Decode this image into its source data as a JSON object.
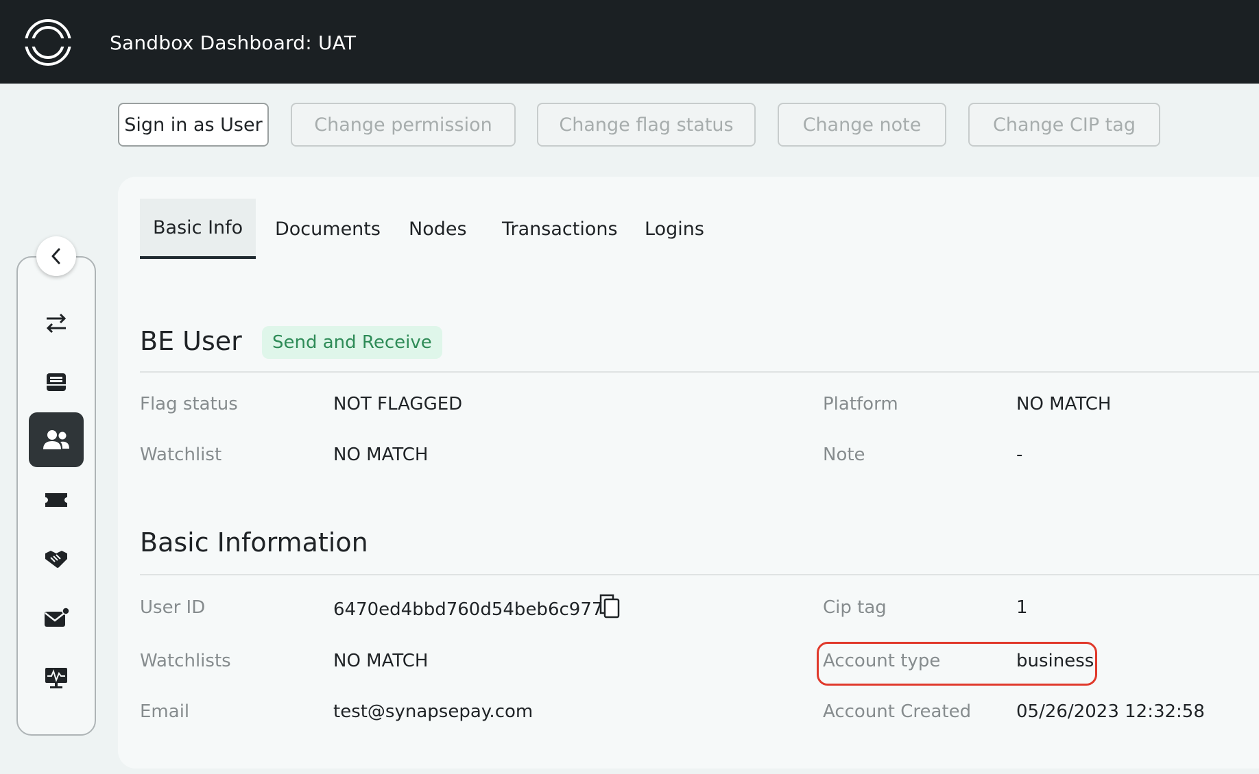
{
  "header": {
    "title": "Sandbox Dashboard: UAT"
  },
  "actions": {
    "sign_in": "Sign in as User",
    "change_permission": "Change permission",
    "change_flag_status": "Change flag status",
    "change_note": "Change note",
    "change_cip_tag": "Change CIP tag"
  },
  "tabs": [
    "Basic Info",
    "Documents",
    "Nodes",
    "Transactions",
    "Logins"
  ],
  "user": {
    "name": "BE User",
    "permission_badge": "Send and Receive"
  },
  "flags": {
    "flag_status_label": "Flag status",
    "flag_status_value": "NOT FLAGGED",
    "watchlist_label": "Watchlist",
    "watchlist_value": "NO MATCH",
    "platform_label": "Platform",
    "platform_value": "NO MATCH",
    "note_label": "Note",
    "note_value": "-"
  },
  "basic_info": {
    "title": "Basic Information",
    "user_id_label": "User ID",
    "user_id_value": "6470ed4bbd760d54beb6c977",
    "watchlists_label": "Watchlists",
    "watchlists_value": "NO MATCH",
    "email_label": "Email",
    "email_value": "test@synapsepay.com",
    "cip_tag_label": "Cip tag",
    "cip_tag_value": "1",
    "account_type_label": "Account type",
    "account_type_value": "business",
    "account_created_label": "Account Created",
    "account_created_value": "05/26/2023 12:32:58"
  },
  "icons": {
    "sidebar": [
      "transfer-icon",
      "inbox-icon",
      "users-icon",
      "ticket-icon",
      "handshake-icon",
      "mail-notification-icon",
      "monitor-pulse-icon"
    ]
  },
  "colors": {
    "topbar": "#1b2023",
    "badge_bg": "#dff6ea",
    "badge_text": "#2e8b57",
    "highlight": "#e0392b"
  }
}
